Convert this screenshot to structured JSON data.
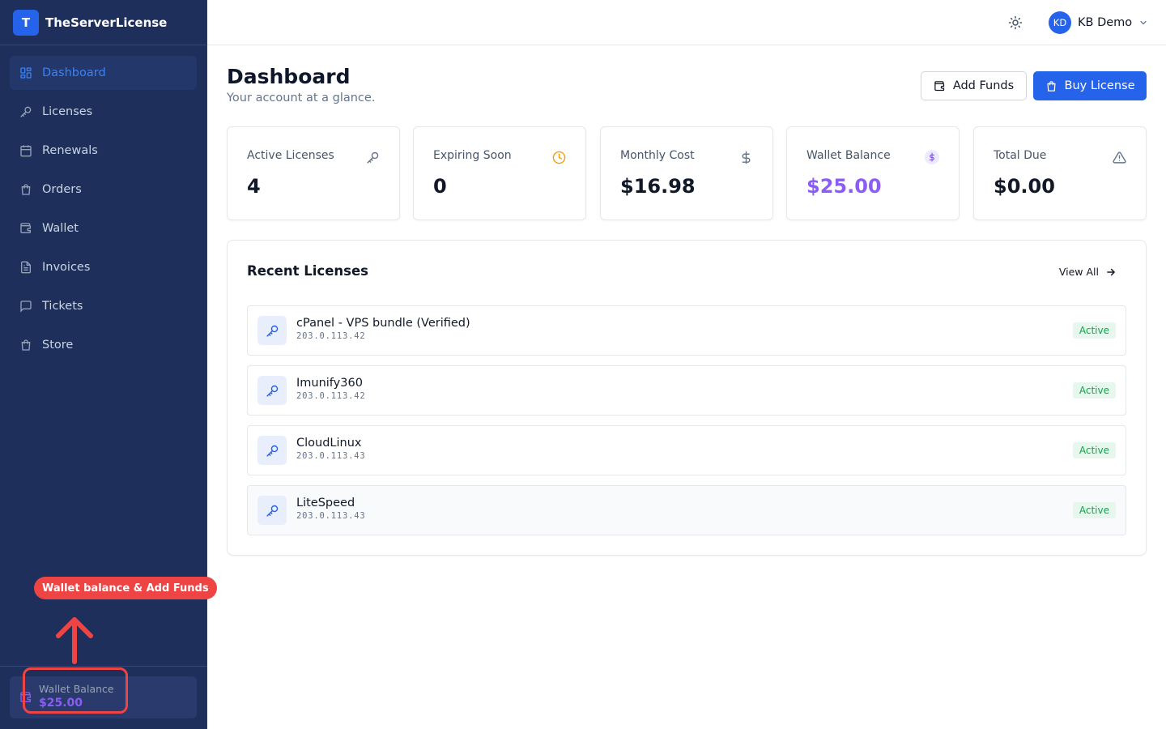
{
  "app": {
    "logo_letter": "T",
    "name": "TheServerLicense"
  },
  "sidebar": {
    "items": [
      {
        "label": "Dashboard",
        "icon": "dashboard-icon",
        "active": true
      },
      {
        "label": "Licenses",
        "icon": "key-icon"
      },
      {
        "label": "Renewals",
        "icon": "calendar-icon"
      },
      {
        "label": "Orders",
        "icon": "shopping-bag-icon"
      },
      {
        "label": "Wallet",
        "icon": "wallet-icon"
      },
      {
        "label": "Invoices",
        "icon": "file-text-icon"
      },
      {
        "label": "Tickets",
        "icon": "message-square-icon"
      },
      {
        "label": "Store",
        "icon": "shopping-bag-icon"
      }
    ],
    "wallet": {
      "label": "Wallet Balance",
      "value": "$25.00"
    }
  },
  "annotation": {
    "label": "Wallet balance & Add Funds",
    "color": "#ef4444"
  },
  "topbar": {
    "theme_icon": "sun-icon",
    "user_initials": "KD",
    "user_name": "KB Demo"
  },
  "page": {
    "title": "Dashboard",
    "subtitle": "Your account at a glance."
  },
  "actions": {
    "add_funds": "Add Funds",
    "buy_license": "Buy License"
  },
  "stats": [
    {
      "label": "Active Licenses",
      "value": "4",
      "icon": "key-icon"
    },
    {
      "label": "Expiring Soon",
      "value": "0",
      "icon": "clock-icon"
    },
    {
      "label": "Monthly Cost",
      "value": "$16.98",
      "icon": "dollar-icon"
    },
    {
      "label": "Wallet Balance",
      "value": "$25.00",
      "icon": "dollar-circle-icon"
    },
    {
      "label": "Total Due",
      "value": "$0.00",
      "icon": "alert-triangle-icon"
    }
  ],
  "recent": {
    "title": "Recent Licenses",
    "view_all": "View All",
    "rows": [
      {
        "name": "cPanel - VPS bundle (Verified)",
        "ip": "203.0.113.42",
        "status": "Active"
      },
      {
        "name": "Imunify360",
        "ip": "203.0.113.42",
        "status": "Active"
      },
      {
        "name": "CloudLinux",
        "ip": "203.0.113.43",
        "status": "Active"
      },
      {
        "name": "LiteSpeed",
        "ip": "203.0.113.43",
        "status": "Active"
      }
    ]
  },
  "colors": {
    "sidebar_bg": "#1e2f5c",
    "accent": "#2563eb",
    "wallet_value": "#8b5cf6",
    "active_badge": "#16a34a",
    "clock": "#f59e0b"
  }
}
